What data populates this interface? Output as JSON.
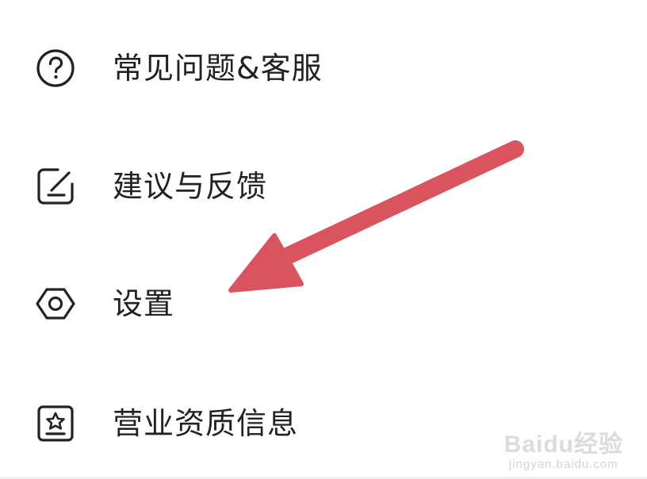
{
  "menu": {
    "items": [
      {
        "label": "常见问题&客服",
        "icon": "question-circle-icon"
      },
      {
        "label": "建议与反馈",
        "icon": "edit-square-icon"
      },
      {
        "label": "设置",
        "icon": "hexagon-gear-icon"
      },
      {
        "label": "营业资质信息",
        "icon": "certificate-badge-icon"
      }
    ]
  },
  "annotation": {
    "type": "arrow",
    "color": "#d9545e",
    "points_to": "设置"
  },
  "watermark": {
    "logo": "Baidu经验",
    "url": "jingyan.baidu.com"
  },
  "colors": {
    "text": "#222222",
    "icon_stroke": "#222222",
    "background": "#ffffff"
  }
}
